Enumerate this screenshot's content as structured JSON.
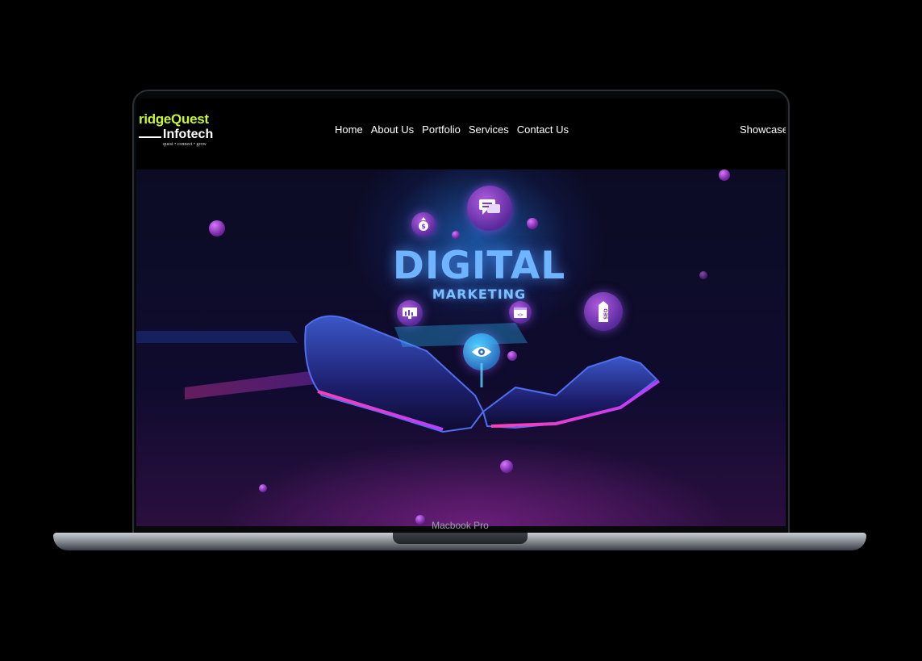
{
  "device": {
    "label": "Macbook Pro"
  },
  "site": {
    "logo": {
      "line1": "ridgeQuest",
      "line2": "Infotech",
      "tagline": "quest • connect • grow"
    },
    "nav": [
      {
        "label": "Home"
      },
      {
        "label": "About Us"
      },
      {
        "label": "Portfolio"
      },
      {
        "label": "Services"
      },
      {
        "label": "Contact Us"
      }
    ],
    "showcase_label": "Showcase"
  },
  "hero": {
    "title": "DIGITAL",
    "subtitle": "MARKETING",
    "icons": [
      "chat-icon",
      "dollar-icon",
      "seo-tag-icon",
      "bar-chart-icon",
      "code-window-icon",
      "eye-icon"
    ]
  },
  "colors": {
    "logo_accent": "#c7f43a",
    "glow": "#6fb4ff",
    "orb": "#9b3fd0"
  }
}
